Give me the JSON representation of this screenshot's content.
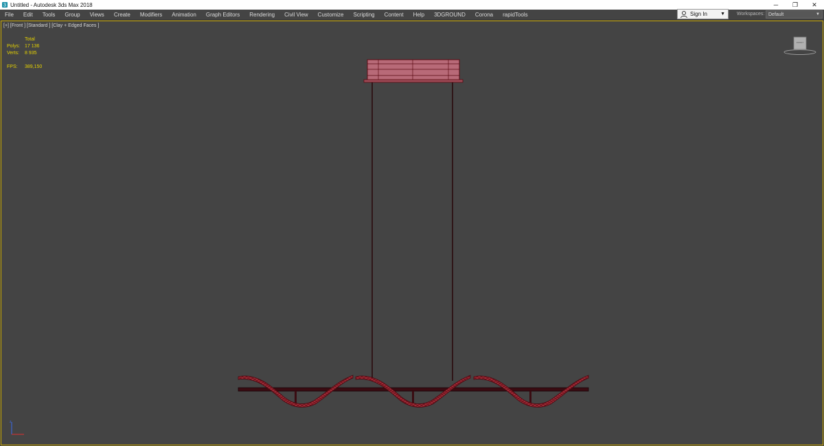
{
  "window": {
    "title": "Untitled - Autodesk 3ds Max 2018",
    "minimize_glyph": "─",
    "restore_glyph": "❐",
    "close_glyph": "✕"
  },
  "menu": {
    "items": [
      "File",
      "Edit",
      "Tools",
      "Group",
      "Views",
      "Create",
      "Modifiers",
      "Animation",
      "Graph Editors",
      "Rendering",
      "Civil View",
      "Customize",
      "Scripting",
      "Content",
      "Help",
      "3DGROUND",
      "Corona",
      "rapidTools"
    ]
  },
  "account": {
    "sign_in_label": "Sign In",
    "workspaces_label": "Workspaces:",
    "workspace_value": "Default"
  },
  "viewport": {
    "label": "[+] [Front ] [Standard ] [Clay + Edged Faces ]",
    "stats": {
      "header": "Total",
      "polys_label": "Polys:",
      "polys_value": "17 136",
      "verts_label": "Verts:",
      "verts_value": "8 935",
      "fps_label": "FPS:",
      "fps_value": "389,150"
    },
    "viewcube_label": "FRONT"
  },
  "colors": {
    "viewport_bg": "#444444",
    "viewport_border": "#c9a800",
    "stats_text": "#e6d200",
    "model_fill": "#b86a78",
    "model_edge": "#5a0a12"
  }
}
